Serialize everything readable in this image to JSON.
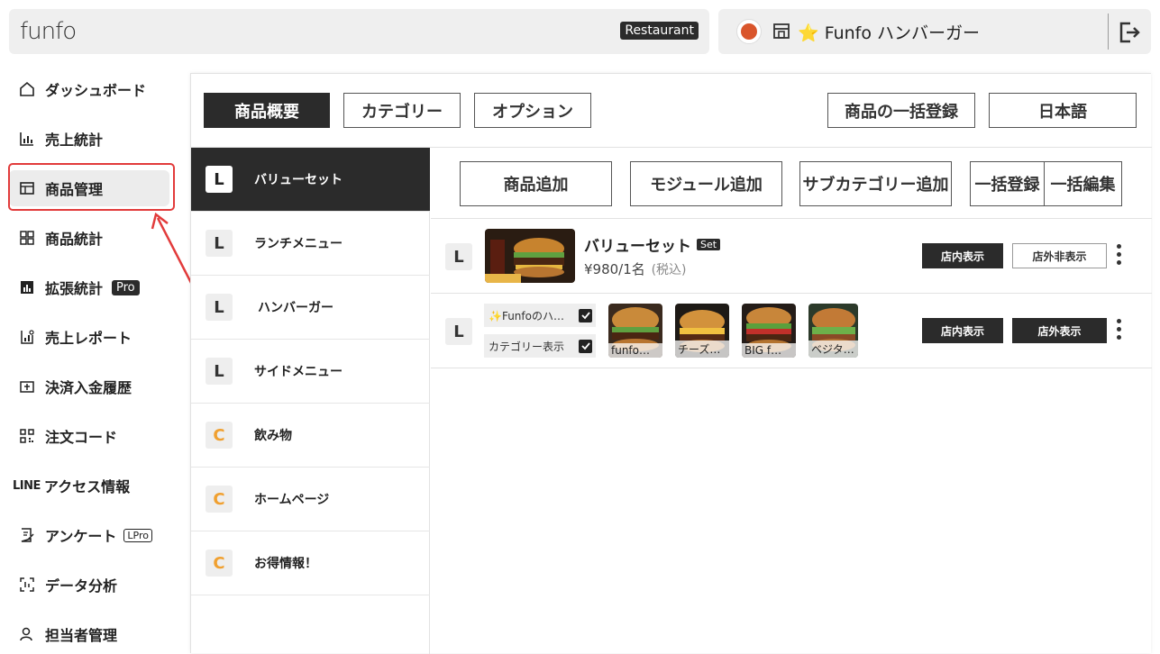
{
  "topbar": {
    "logo": "funfo",
    "tag": "Restaurant",
    "store_name": "⭐ Funfo ハンバーガー"
  },
  "sidebar": {
    "items": [
      {
        "label": "ダッシュボード",
        "icon": "home-icon"
      },
      {
        "label": "売上統計",
        "icon": "bar-chart-icon"
      },
      {
        "label": "商品管理",
        "icon": "product-panel-icon"
      },
      {
        "label": "商品統計",
        "icon": "grid-icon"
      },
      {
        "label": "拡張統計",
        "icon": "chart-box-icon",
        "badge": "Pro"
      },
      {
        "label": "売上レポート",
        "icon": "report-icon"
      },
      {
        "label": "決済入金履歴",
        "icon": "payment-history-icon"
      },
      {
        "label": "注文コード",
        "icon": "qr-code-icon"
      },
      {
        "label": "アクセス情報",
        "icon": "line-logo",
        "prefix": "LINE"
      },
      {
        "label": "アンケート",
        "icon": "survey-icon",
        "badge": "LPro"
      },
      {
        "label": "データ分析",
        "icon": "data-analysis-icon"
      },
      {
        "label": "担当者管理",
        "icon": "staff-icon"
      }
    ],
    "active_index": 2
  },
  "tabs": {
    "overview": "商品概要",
    "category": "カテゴリー",
    "option": "オプション",
    "bulk_register": "商品の一括登録",
    "language": "日本語"
  },
  "categories": [
    {
      "badge": "L",
      "label": "バリューセット",
      "active": true
    },
    {
      "badge": "L",
      "label": "ランチメニュー"
    },
    {
      "badge": "L",
      "label": "ハンバーガー"
    },
    {
      "badge": "L",
      "label": "サイドメニュー"
    },
    {
      "badge": "C",
      "label": "飲み物"
    },
    {
      "badge": "C",
      "label": "ホームページ"
    },
    {
      "badge": "C",
      "label": "お得情報！"
    }
  ],
  "actions": {
    "add_product": "商品追加",
    "add_module": "モジュール追加",
    "add_subcategory": "サブカテゴリー追加",
    "bulk_register": "一括登録",
    "bulk_edit": "一括編集"
  },
  "products": [
    {
      "badge": "L",
      "name": "バリューセット",
      "set_tag": "Set",
      "price": "¥980/1名",
      "tax": "(税込)",
      "btn_in_store": "店内表示",
      "btn_out_store": "店外非表示"
    },
    {
      "badge": "L",
      "module_title": "✨Funfoのハ…",
      "module_cat": "カテゴリー表示",
      "thumbs": [
        "funfo…",
        "チーズ…",
        "BIG f…",
        "ベジタ…"
      ],
      "btn_in_store": "店内表示",
      "btn_out_store": "店外表示"
    }
  ],
  "colors": {
    "dark": "#2b2b2b",
    "highlight": "#e23b3b",
    "c_badge": "#f0a030"
  }
}
